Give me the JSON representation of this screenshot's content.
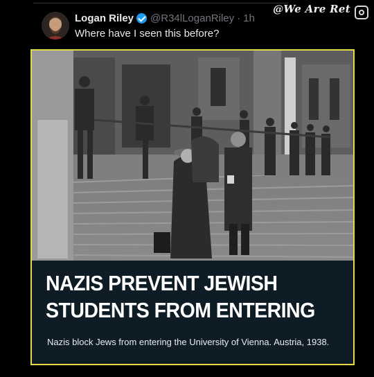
{
  "watermark": {
    "text": "@We Are Ret"
  },
  "tweet": {
    "author_name": "Logan Riley",
    "handle": "@R34lLoganRiley",
    "separator": "·",
    "time": "1h",
    "text": "Where have I seen this before?"
  },
  "card": {
    "headline": "NAZIS PREVENT JEWISH STUDENTS FROM ENTERING",
    "caption": "Nazis block Jews from entering the University of Vienna. Austria, 1938.",
    "border_color": "#e7d94a",
    "background_color": "#0e1c26"
  },
  "colors": {
    "verified": "#1d9bf0",
    "muted": "#71767b"
  },
  "icons": [
    "verified-badge-icon",
    "watermark-camera-icon"
  ]
}
